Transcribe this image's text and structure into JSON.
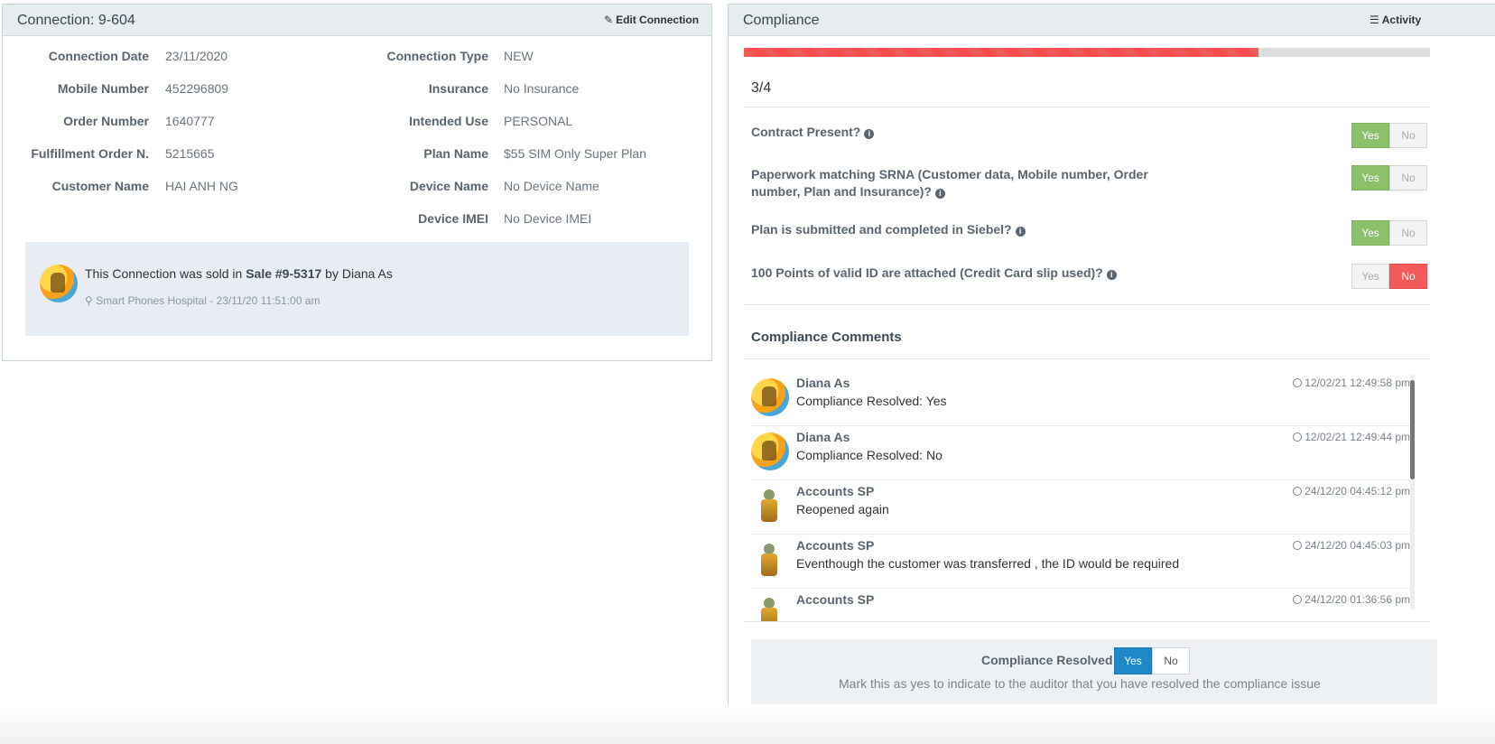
{
  "connection": {
    "title": "Connection: 9-604",
    "edit_label": "Edit Connection",
    "fields_left": [
      {
        "label": "Connection Date",
        "value": "23/11/2020"
      },
      {
        "label": "Mobile Number",
        "value": "452296809"
      },
      {
        "label": "Order Number",
        "value": "1640777"
      },
      {
        "label": "Fulfillment Order N.",
        "value": "5215665"
      },
      {
        "label": "Customer Name",
        "value": "HAI ANH NG"
      }
    ],
    "fields_right": [
      {
        "label": "Connection Type",
        "value": "NEW"
      },
      {
        "label": "Insurance",
        "value": "No Insurance"
      },
      {
        "label": "Intended Use",
        "value": "PERSONAL"
      },
      {
        "label": "Plan Name",
        "value": "$55 SIM Only Super Plan"
      },
      {
        "label": "Device Name",
        "value": "No Device Name"
      },
      {
        "label": "Device IMEI",
        "value": "No Device IMEI"
      }
    ],
    "sale": {
      "prefix": "This Connection was sold in",
      "sale_link": "Sale #9-5317",
      "by": "by Diana As",
      "location": "Smart Phones Hospital - 23/11/20 11:51:00 am"
    }
  },
  "compliance": {
    "title": "Compliance",
    "activity_label": "Activity",
    "progress_text": "3/4",
    "progress_fraction": 0.75,
    "progress_color": "#f25a5a",
    "questions": [
      {
        "text": "Contract Present?",
        "answer": "Yes"
      },
      {
        "text": "Paperwork matching SRNA (Customer data, Mobile number, Order number, Plan and Insurance)?",
        "answer": "Yes"
      },
      {
        "text": "Plan is submitted and completed in Siebel?",
        "answer": "Yes"
      },
      {
        "text": "100 Points of valid ID are attached (Credit Card slip used)?",
        "answer": "No"
      }
    ],
    "yes_label": "Yes",
    "no_label": "No",
    "comments_title": "Compliance Comments",
    "comments": [
      {
        "name": "Diana As",
        "time": "12/02/21 12:49:58 pm",
        "text": "Compliance Resolved: Yes",
        "avatar": "badge"
      },
      {
        "name": "Diana As",
        "time": "12/02/21 12:49:44 pm",
        "text": "Compliance Resolved: No",
        "avatar": "badge"
      },
      {
        "name": "Accounts SP",
        "time": "24/12/20 04:45:12 pm",
        "text": "Reopened again",
        "avatar": "figure"
      },
      {
        "name": "Accounts SP",
        "time": "24/12/20 04:45:03 pm",
        "text": "Eventhough the customer was transferred , the ID would be required",
        "avatar": "figure"
      },
      {
        "name": "Accounts SP",
        "time": "24/12/20 01:36:56 pm",
        "text": "",
        "avatar": "figure"
      }
    ],
    "resolved": {
      "label": "Compliance Resolved",
      "selected": "Yes",
      "help": "Mark this as yes to indicate to the auditor that you have resolved the compliance issue"
    }
  }
}
